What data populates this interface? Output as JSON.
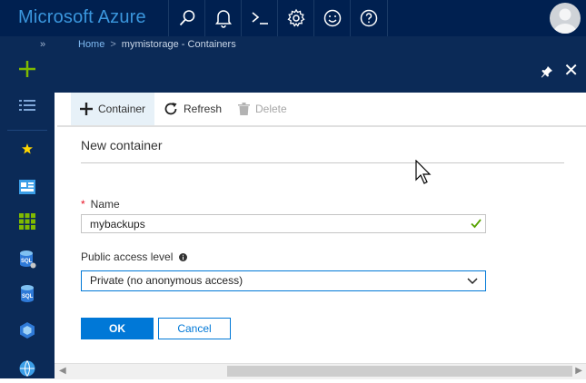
{
  "app": {
    "title": "Microsoft Azure"
  },
  "header_icons": [
    "search-icon",
    "bell-icon",
    "cloud-shell-icon",
    "settings-icon",
    "smiley-icon",
    "help-icon"
  ],
  "breadcrumb": {
    "home": "Home",
    "separator": ">",
    "current": "mymistorage - Containers"
  },
  "toolbar": {
    "container_label": "Container",
    "refresh_label": "Refresh",
    "delete_label": "Delete"
  },
  "form": {
    "title": "New container",
    "name_required_mark": "*",
    "name_label": "Name",
    "name_value": "mybackups",
    "access_label": "Public access level",
    "access_value": "Private (no anonymous access)",
    "ok_label": "OK",
    "cancel_label": "Cancel"
  },
  "colors": {
    "topbar": "#002050",
    "nav": "#0b2a57",
    "brand": "#3a96dd",
    "accent": "#0078d7",
    "success": "#57a300"
  }
}
